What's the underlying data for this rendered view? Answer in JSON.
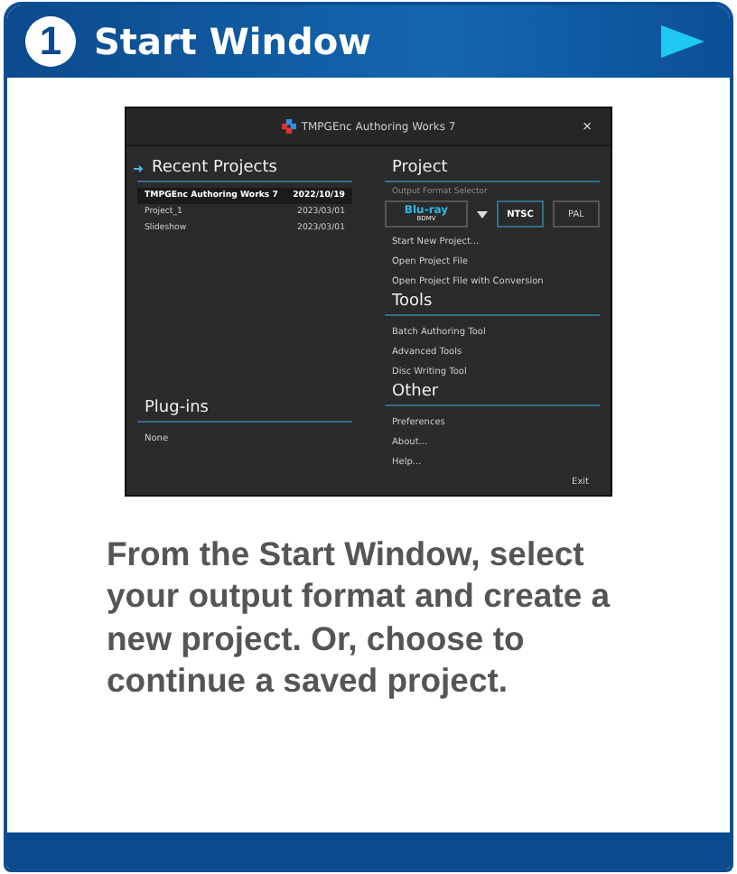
{
  "header": {
    "step": "1",
    "title": "Start Window"
  },
  "app": {
    "title": "TMPGEnc Authoring Works 7",
    "close": "×",
    "recent": {
      "heading": "Recent Projects",
      "items": [
        {
          "name": "TMPGEnc Authoring Works 7",
          "date": "2022/10/19",
          "selected": true
        },
        {
          "name": "Project_1",
          "date": "2023/03/01",
          "selected": false
        },
        {
          "name": "Slideshow",
          "date": "2023/03/01",
          "selected": false
        }
      ]
    },
    "plugins": {
      "heading": "Plug-ins",
      "items": [
        "None"
      ]
    },
    "project": {
      "heading": "Project",
      "selector_label": "Output Format Selector",
      "format": "Blu-ray",
      "format_sub": "BDMV",
      "standards": [
        {
          "label": "NTSC",
          "selected": true
        },
        {
          "label": "PAL",
          "selected": false
        }
      ],
      "items": [
        "Start New Project...",
        "Open Project File",
        "Open Project File with Conversion"
      ]
    },
    "tools": {
      "heading": "Tools",
      "items": [
        "Batch Authoring Tool",
        "Advanced Tools",
        "Disc Writing Tool"
      ]
    },
    "other": {
      "heading": "Other",
      "items": [
        "Preferences",
        "About...",
        "Help..."
      ]
    },
    "exit": "Exit"
  },
  "description": "From the Start Window, select your output format and create a new project. Or, choose to continue a saved project."
}
